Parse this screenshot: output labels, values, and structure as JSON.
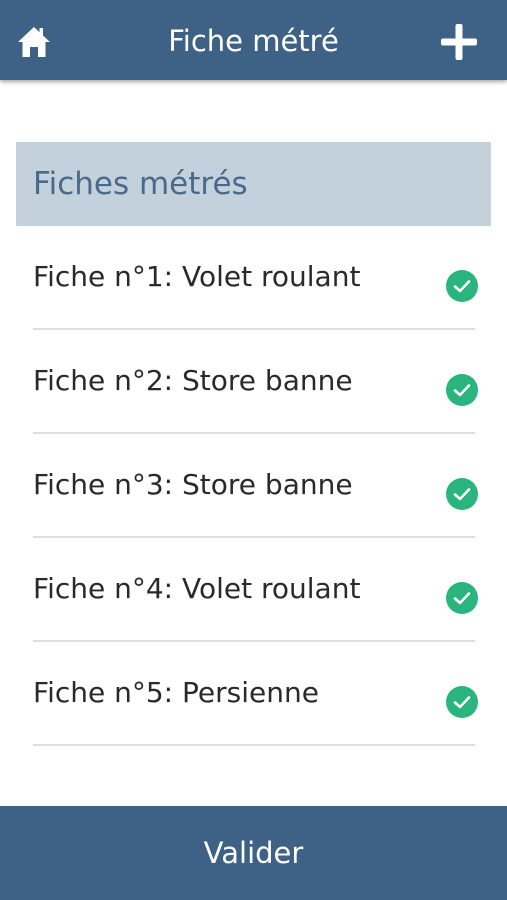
{
  "header": {
    "title": "Fiche métré",
    "home_icon": "home-icon",
    "add_icon": "plus-icon",
    "background_color": "#3e6285"
  },
  "section": {
    "title": "Fiches métrés",
    "background_color": "#c3d1dc",
    "text_color": "#4a6a8b"
  },
  "list": {
    "items": [
      {
        "label": "Fiche n°1: Volet roulant",
        "status_icon": "check-circle-icon"
      },
      {
        "label": "Fiche n°2: Store banne",
        "status_icon": "check-circle-icon"
      },
      {
        "label": "Fiche n°3: Store banne",
        "status_icon": "check-circle-icon"
      },
      {
        "label": "Fiche n°4: Volet roulant",
        "status_icon": "check-circle-icon"
      },
      {
        "label": "Fiche n°5: Persienne",
        "status_icon": "check-circle-icon"
      }
    ],
    "check_color": "#2bb57e"
  },
  "footer": {
    "validate_label": "Valider"
  }
}
